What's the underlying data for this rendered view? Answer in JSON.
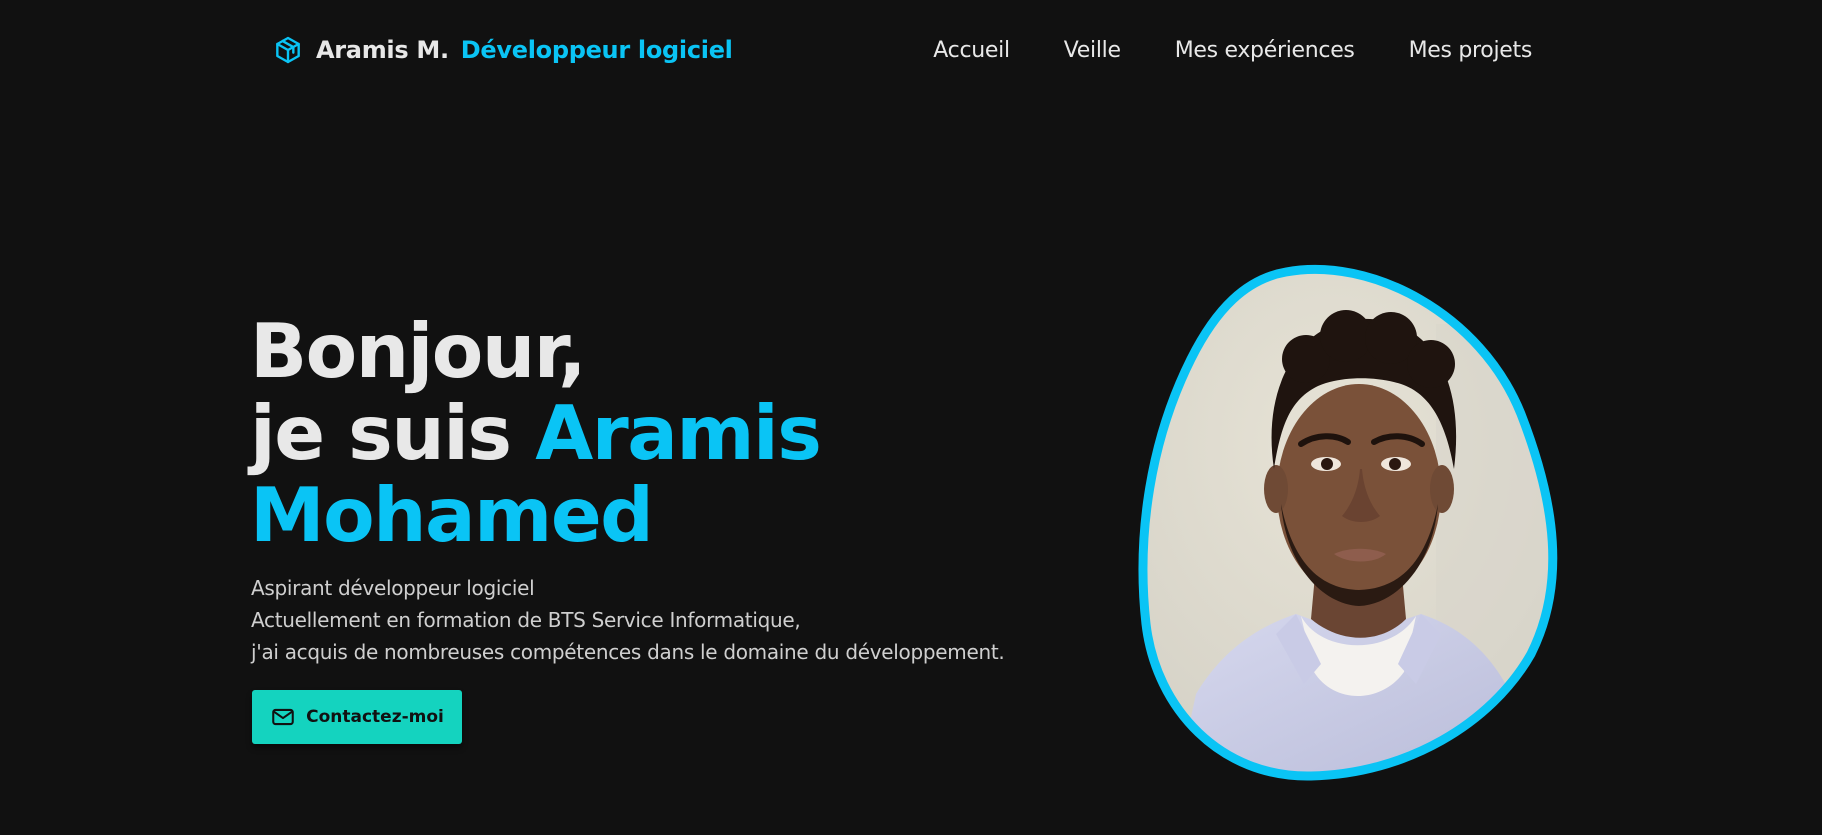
{
  "header": {
    "brand_icon": "cube-icon",
    "brand_name": "Aramis M.",
    "brand_role": "Développeur logiciel",
    "nav": [
      {
        "label": "Accueil"
      },
      {
        "label": "Veille"
      },
      {
        "label": "Mes expériences"
      },
      {
        "label": "Mes projets"
      }
    ]
  },
  "hero": {
    "greeting": "Bonjour,",
    "intro": "je suis",
    "first_name": "Aramis",
    "last_name": "Mohamed",
    "description": [
      "Aspirant développeur logiciel",
      "Actuellement en formation de BTS Service Informatique,",
      "j'ai acquis de nombreuses compétences dans le domaine du développement."
    ],
    "cta_label": "Contactez-moi",
    "cta_icon": "mail-icon",
    "portrait_image": "portrait-photo"
  },
  "colors": {
    "background": "#111111",
    "text": "#e8e8e8",
    "accent": "#0ac4f5",
    "cta": "#14d3bf"
  }
}
